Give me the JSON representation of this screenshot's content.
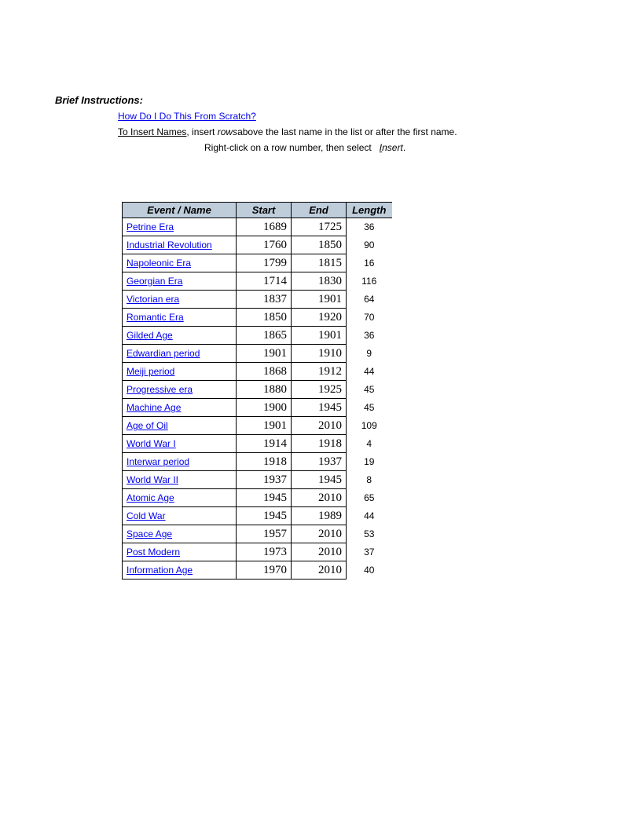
{
  "header": {
    "title": "Brief Instructions:",
    "scratch_link": "How Do I Do This From Scratch?",
    "insert_prefix_u": "To Insert Names",
    "insert_mid": ", insert ",
    "insert_rows_i": "rows",
    "insert_suffix": "above the last name in the list or after the first name.",
    "line3a": "Right-click on a row number, then select ",
    "line3b_u": "I",
    "line3b_rest": "nsert",
    "line3c": "."
  },
  "table": {
    "headers": {
      "name": "Event / Name",
      "start": "Start",
      "end": "End",
      "length": "Length"
    },
    "rows": [
      {
        "name": "Petrine Era",
        "start": "1689",
        "end": "1725",
        "length": "36"
      },
      {
        "name": "Industrial Revolution",
        "start": "1760",
        "end": "1850",
        "length": "90"
      },
      {
        "name": "Napoleonic Era",
        "start": "1799",
        "end": "1815",
        "length": "16"
      },
      {
        "name": "Georgian Era",
        "start": "1714",
        "end": "1830",
        "length": "116"
      },
      {
        "name": "Victorian era",
        "start": "1837",
        "end": "1901",
        "length": "64"
      },
      {
        "name": "Romantic Era",
        "start": "1850",
        "end": "1920",
        "length": "70"
      },
      {
        "name": "Gilded Age",
        "start": "1865",
        "end": "1901",
        "length": "36"
      },
      {
        "name": "Edwardian period",
        "start": "1901",
        "end": "1910",
        "length": "9"
      },
      {
        "name": "Meiji period",
        "start": "1868",
        "end": "1912",
        "length": "44"
      },
      {
        "name": "Progressive era",
        "start": "1880",
        "end": "1925",
        "length": "45"
      },
      {
        "name": "Machine Age",
        "start": "1900",
        "end": "1945",
        "length": "45"
      },
      {
        "name": "Age of Oil",
        "start": "1901",
        "end": "2010",
        "length": "109"
      },
      {
        "name": "World War I",
        "start": "1914",
        "end": "1918",
        "length": "4"
      },
      {
        "name": "Interwar period",
        "start": "1918",
        "end": "1937",
        "length": "19"
      },
      {
        "name": "World War II",
        "start": "1937",
        "end": "1945",
        "length": "8"
      },
      {
        "name": "Atomic Age",
        "start": "1945",
        "end": "2010",
        "length": "65"
      },
      {
        "name": "Cold War",
        "start": "1945",
        "end": "1989",
        "length": "44"
      },
      {
        "name": "Space Age",
        "start": "1957",
        "end": "2010",
        "length": "53"
      },
      {
        "name": "Post Modern",
        "start": "1973",
        "end": "2010",
        "length": "37"
      },
      {
        "name": "Information Age",
        "start": "1970",
        "end": "2010",
        "length": "40"
      }
    ]
  }
}
